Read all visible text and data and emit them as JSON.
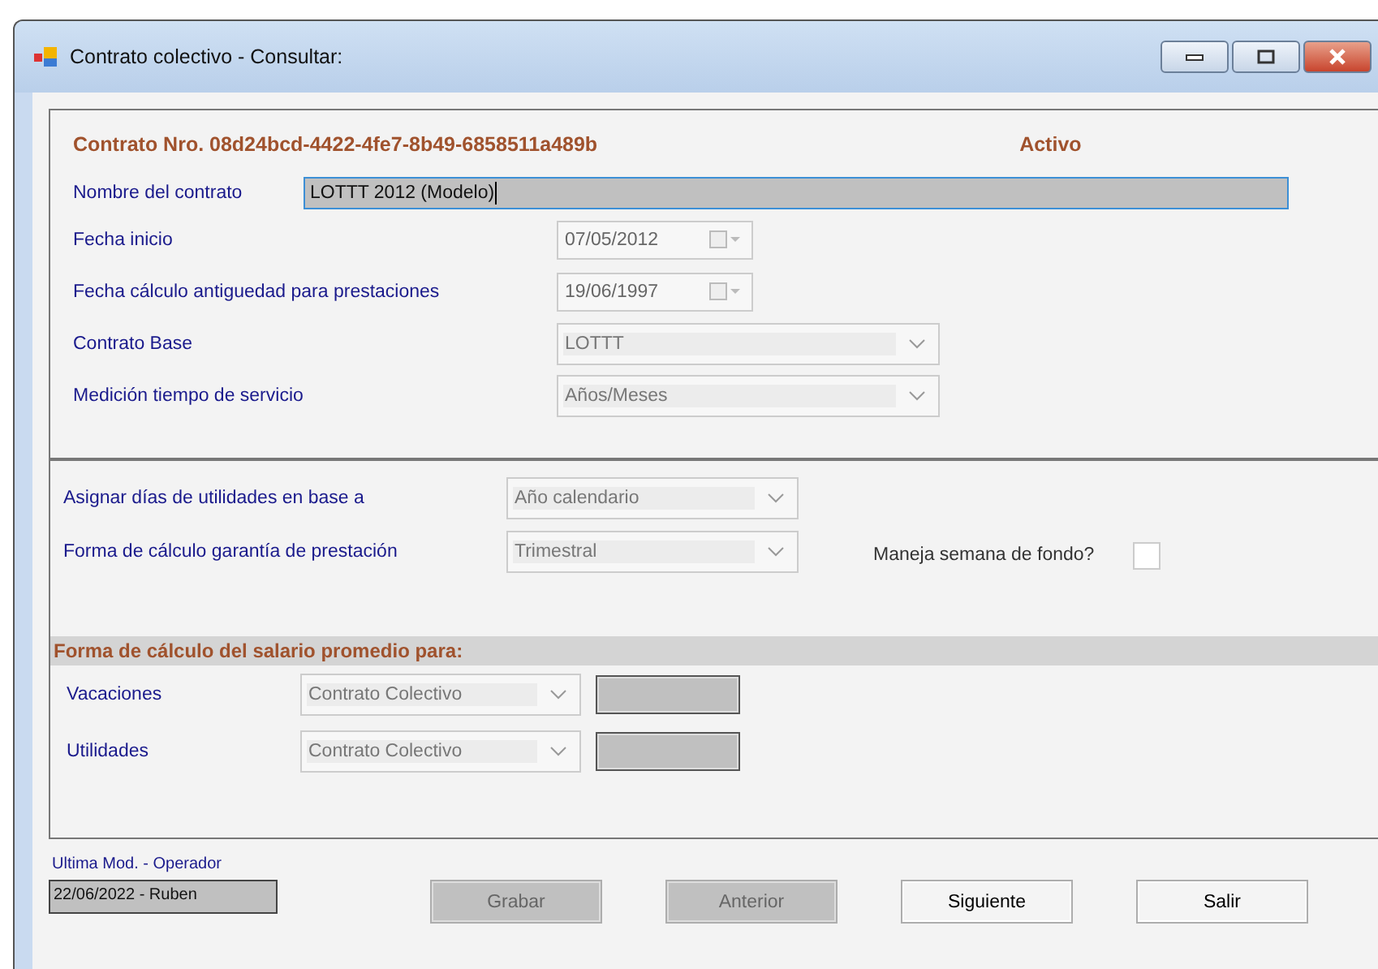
{
  "window": {
    "title": "Contrato colectivo - Consultar:"
  },
  "contract": {
    "number": "Contrato Nro. 08d24bcd-4422-4fe7-8b49-6858511a489b",
    "status": "Activo"
  },
  "fields": [
    {
      "kind": "text",
      "label": "Nombre del contrato",
      "value": "LOTTT 2012 (Modelo)"
    },
    {
      "kind": "date",
      "label": "Fecha inicio",
      "value": "07/05/2012"
    },
    {
      "kind": "date",
      "label": "Fecha cálculo antiguedad para prestaciones",
      "value": "19/06/1997"
    },
    {
      "kind": "combo",
      "label": "Contrato Base",
      "value": "LOTTT"
    },
    {
      "kind": "combo",
      "label": "Medición tiempo de servicio",
      "value": "Años/Meses"
    }
  ],
  "options": [
    {
      "label": "Asignar días de utilidades en base a",
      "value": "Año calendario"
    },
    {
      "label": "Forma de cálculo garantía  de prestación",
      "value": "Trimestral"
    }
  ],
  "fondo": {
    "label": "Maneja semana de fondo?",
    "checked": false
  },
  "salary": {
    "title": "Forma de cálculo del salario promedio para:",
    "rows": [
      {
        "label": "Vacaciones",
        "value": "Contrato Colectivo"
      },
      {
        "label": "Utilidades",
        "value": "Contrato Colectivo"
      }
    ]
  },
  "footer": {
    "label": "Ultima Mod. - Operador",
    "value": "22/06/2022 - Ruben"
  },
  "buttons": [
    {
      "label": "Grabar",
      "disabled": true
    },
    {
      "label": "Anterior",
      "disabled": true
    },
    {
      "label": "Siguiente",
      "disabled": false
    },
    {
      "label": "Salir",
      "disabled": false
    }
  ]
}
